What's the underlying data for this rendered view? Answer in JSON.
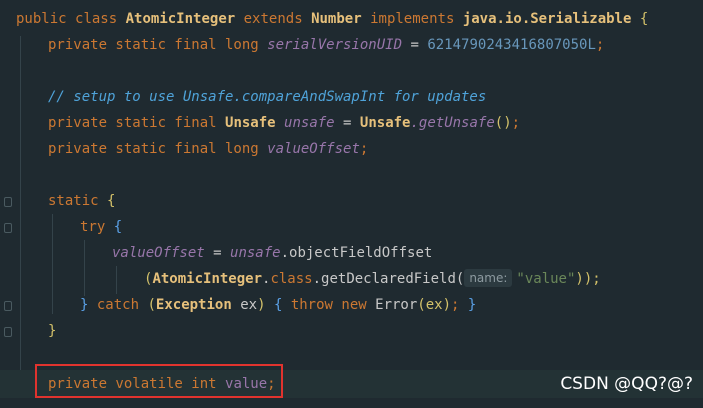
{
  "code": {
    "l1": {
      "kw_public": "public",
      "kw_class": "class",
      "cls_name": "AtomicInteger",
      "kw_extends": "extends",
      "parent": "Number",
      "kw_implements": "implements",
      "iface": "java.io.Serializable",
      "brace": "{"
    },
    "l2": {
      "mods": "private static final long",
      "name": "serialVersionUID",
      "eq": " = ",
      "val": "6214790243416807050L",
      "semi": ";"
    },
    "l3": {
      "comment": "// setup to use Unsafe.compareAndSwapInt for updates"
    },
    "l4": {
      "mods": "private static final",
      "type": "Unsafe",
      "name": "unsafe",
      "eq": " = ",
      "cls": "Unsafe",
      "call": ".getUnsafe",
      "paren": "()",
      "semi": ";"
    },
    "l5": {
      "mods": "private static final long",
      "name": "valueOffset",
      "semi": ";"
    },
    "l6": {
      "kw": "static",
      "brace": "{"
    },
    "l7": {
      "kw": "try",
      "brace": "{"
    },
    "l8": {
      "name": "valueOffset",
      "eq": " = ",
      "obj": "unsafe",
      "call": ".objectFieldOffset"
    },
    "l9": {
      "open": "(",
      "cls": "AtomicInteger",
      "dot_class": ".",
      "kw_class": "class",
      "call": ".getDeclaredField(",
      "hint": "name:",
      "str": "\"value\"",
      "close": "));"
    },
    "l10": {
      "close_brace": "}",
      "kw_catch": "catch",
      "open": "(",
      "type": "Exception",
      "var": "ex",
      "close": ")",
      "brace": "{",
      "kw_throw": "throw",
      "kw_new": "new",
      "err": "Error",
      "args": "(ex)",
      "semi": ";",
      "end": "}"
    },
    "l11": {
      "brace": "}"
    },
    "l12": {
      "mods": "private volatile int",
      "name": "value",
      "semi": ";"
    }
  },
  "watermark": "CSDN @QQ?@?",
  "colors": {
    "highlight_box": "#e0332e",
    "background": "#1f2a30"
  }
}
